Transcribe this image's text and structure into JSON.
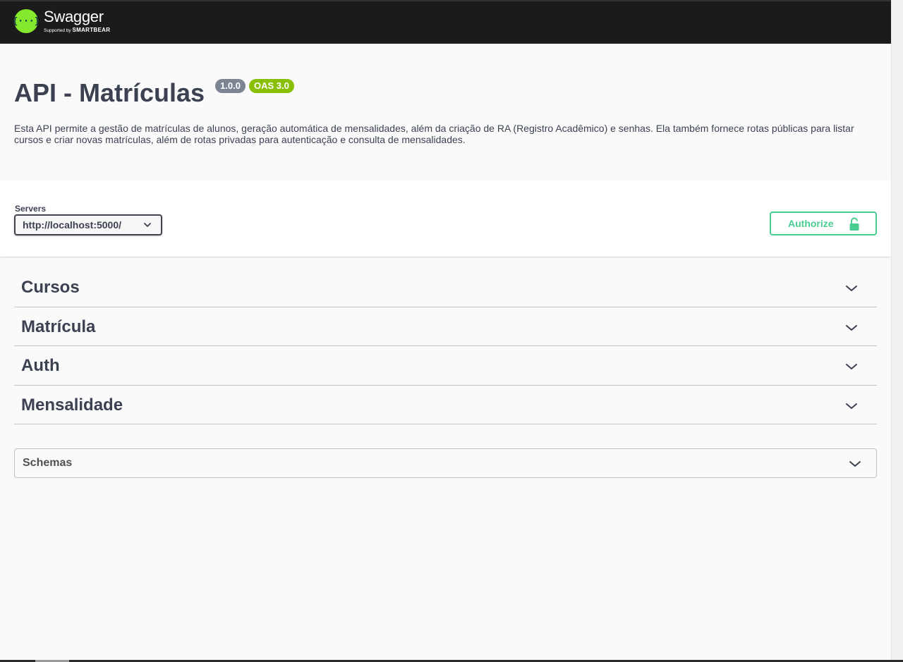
{
  "topbar": {
    "logo_symbol": "{···}",
    "logo_title": "Swagger",
    "logo_sub_prefix": "Supported by",
    "logo_sub_brand": "SMARTBEAR"
  },
  "info": {
    "title": "API - Matrículas",
    "version": "1.0.0",
    "oas": "OAS 3.0",
    "description": "Esta API permite a gestão de matrículas de alunos, geração automática de mensalidades, além da criação de RA (Registro Acadêmico) e senhas. Ela também fornece rotas públicas para listar cursos e criar novas matrículas, além de rotas privadas para autenticação e consulta de mensalidades."
  },
  "servers": {
    "label": "Servers",
    "selected": "http://localhost:5000/"
  },
  "authorize": {
    "label": "Authorize",
    "icon": "unlocked-icon"
  },
  "tags": [
    {
      "name": "Cursos"
    },
    {
      "name": "Matrícula"
    },
    {
      "name": "Auth"
    },
    {
      "name": "Mensalidade"
    }
  ],
  "schemas": {
    "label": "Schemas"
  },
  "colors": {
    "topbar": "#1b1b1b",
    "logo_green": "#85ea2d",
    "authorize_green": "#49cc90",
    "version_badge": "#7d8492",
    "oas_badge": "#89bf04",
    "text": "#3b4151"
  }
}
